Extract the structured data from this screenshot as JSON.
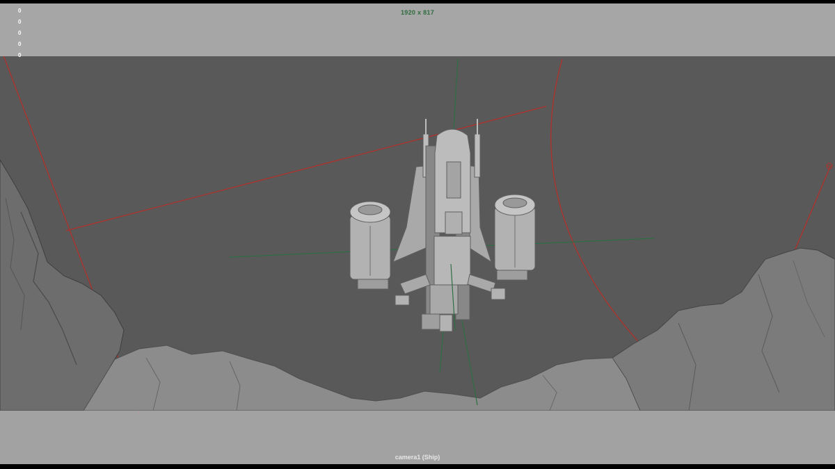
{
  "viewport": {
    "resolution_gate": "1920 x 817",
    "camera_label": "camera1 (Ship)",
    "hud_values": [
      "0",
      "0",
      "0",
      "0",
      "0"
    ]
  },
  "colors": {
    "background": "#595959",
    "gate_mask": "#acacac",
    "manipulator_red": "#b0302a",
    "axis_green": "#2e6e44",
    "model_gray": "#b5b5b5",
    "terrain_gray": "#7d7d7d"
  },
  "icons": {
    "camera_handle": "camera-handle-icon"
  }
}
